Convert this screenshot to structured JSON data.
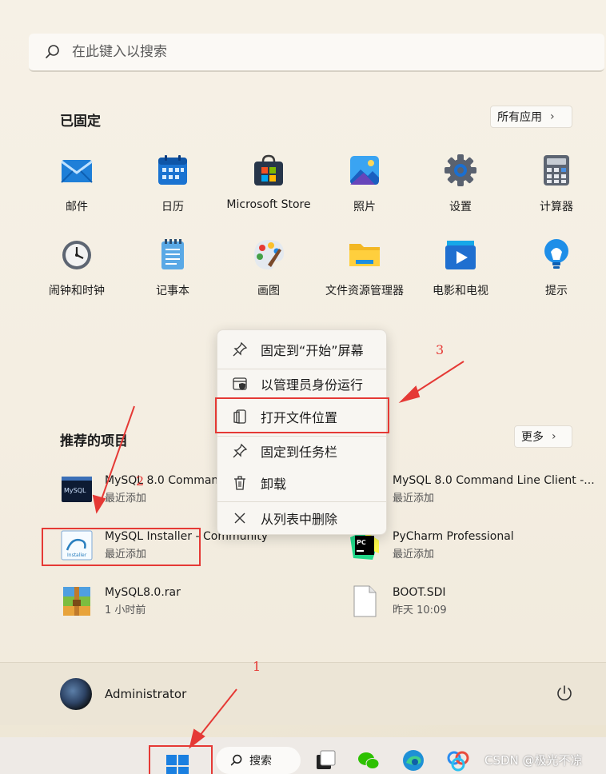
{
  "search": {
    "placeholder": "在此键入以搜索"
  },
  "pinned": {
    "title": "已固定",
    "all_apps_label": "所有应用",
    "apps": [
      {
        "label": "邮件",
        "icon": "mail-icon"
      },
      {
        "label": "日历",
        "icon": "calendar-icon"
      },
      {
        "label": "Microsoft Store",
        "icon": "store-icon"
      },
      {
        "label": "照片",
        "icon": "photos-icon"
      },
      {
        "label": "设置",
        "icon": "settings-icon"
      },
      {
        "label": "计算器",
        "icon": "calculator-icon"
      },
      {
        "label": "闹钟和时钟",
        "icon": "clock-icon"
      },
      {
        "label": "记事本",
        "icon": "notepad-icon"
      },
      {
        "label": "画图",
        "icon": "paint-icon"
      },
      {
        "label": "文件资源管理器",
        "icon": "folder-icon"
      },
      {
        "label": "电影和电视",
        "icon": "movies-icon"
      },
      {
        "label": "提示",
        "icon": "tips-icon"
      }
    ]
  },
  "recommended": {
    "title": "推荐的项目",
    "more_label": "更多",
    "items": [
      {
        "name": "MySQL 8.0 Command",
        "sub": "最近添加",
        "icon": "mysql-cmd-icon"
      },
      {
        "name": "MySQL 8.0 Command Line Client -...",
        "sub": "最近添加",
        "icon": "mysql-cmd-icon"
      },
      {
        "name": "MySQL Installer - Community",
        "sub": "最近添加",
        "icon": "mysql-installer-icon"
      },
      {
        "name": "PyCharm Professional",
        "sub": "最近添加",
        "icon": "pycharm-icon"
      },
      {
        "name": "MySQL8.0.rar",
        "sub": "1 小时前",
        "icon": "rar-icon"
      },
      {
        "name": "BOOT.SDI",
        "sub": "昨天 10:09",
        "icon": "file-icon"
      }
    ]
  },
  "context_menu": {
    "items": [
      {
        "label": "固定到“开始”屏幕",
        "icon": "pin-icon"
      },
      {
        "label": "以管理员身份运行",
        "icon": "shield-icon"
      },
      {
        "label": "打开文件位置",
        "icon": "open-file-location-icon"
      },
      {
        "label": "固定到任务栏",
        "icon": "pin-icon"
      },
      {
        "label": "卸载",
        "icon": "trash-icon"
      },
      {
        "label": "从列表中删除",
        "icon": "close-icon"
      }
    ]
  },
  "user": {
    "name": "Administrator"
  },
  "taskbar": {
    "search_label": "搜索"
  },
  "annotations": {
    "a1": "1",
    "a2": "2",
    "a3": "3"
  },
  "watermark": "CSDN @极光不凉",
  "colors": {
    "annotation_red": "#e53935",
    "accent_blue": "#0a64c9"
  }
}
